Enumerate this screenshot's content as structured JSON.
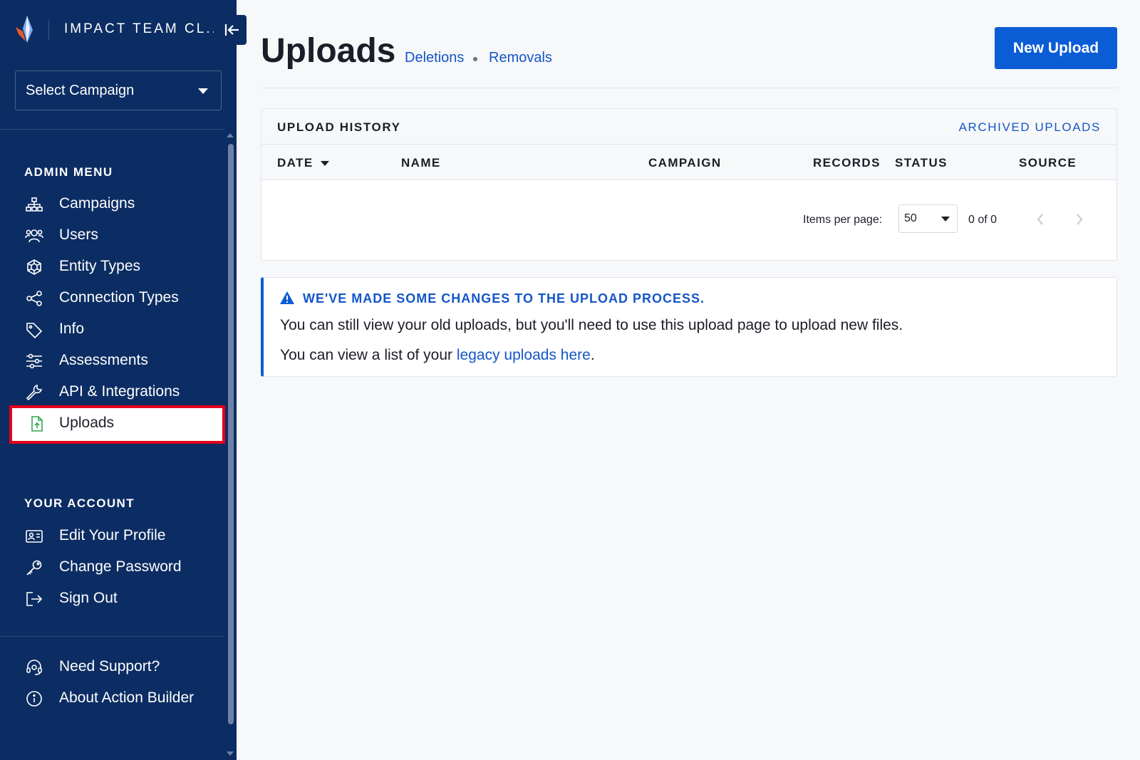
{
  "sidebar": {
    "org_name": "IMPACT TEAM CL...",
    "campaign_select": {
      "value": "Select Campaign"
    },
    "admin_menu_title": "ADMIN MENU",
    "admin_items": [
      {
        "label": "Campaigns",
        "icon": "sitemap-icon"
      },
      {
        "label": "Users",
        "icon": "users-icon"
      },
      {
        "label": "Entity Types",
        "icon": "hexagon-cube-icon"
      },
      {
        "label": "Connection Types",
        "icon": "share-nodes-icon"
      },
      {
        "label": "Info",
        "icon": "tag-icon"
      },
      {
        "label": "Assessments",
        "icon": "sliders-icon"
      },
      {
        "label": "API & Integrations",
        "icon": "wrench-icon"
      },
      {
        "label": "Uploads",
        "icon": "file-upload-icon",
        "active": true
      }
    ],
    "account_title": "YOUR ACCOUNT",
    "account_items": [
      {
        "label": "Edit Your Profile",
        "icon": "id-card-icon"
      },
      {
        "label": "Change Password",
        "icon": "key-icon"
      },
      {
        "label": "Sign Out",
        "icon": "sign-out-icon"
      }
    ],
    "footer_items": [
      {
        "label": "Need Support?",
        "icon": "headset-icon"
      },
      {
        "label": "About Action Builder",
        "icon": "info-circle-icon"
      }
    ]
  },
  "header": {
    "title": "Uploads",
    "links": [
      "Deletions",
      "Removals"
    ],
    "new_upload_label": "New Upload"
  },
  "upload_history": {
    "title": "UPLOAD HISTORY",
    "archived_link": "ARCHIVED UPLOADS",
    "columns": [
      "DATE",
      "NAME",
      "CAMPAIGN",
      "RECORDS",
      "STATUS",
      "SOURCE"
    ],
    "sorted_column": "DATE",
    "rows": [],
    "paginator": {
      "items_per_page_label": "Items per page:",
      "items_per_page_value": "50",
      "range_label": "0 of 0"
    }
  },
  "notice": {
    "title": "WE'VE MADE SOME CHANGES TO THE UPLOAD PROCESS.",
    "line1": "You can still view your old uploads, but you'll need to use this upload page to upload new files.",
    "line2_prefix": "You can view a list of your ",
    "line2_link": "legacy uploads here",
    "line2_suffix": "."
  },
  "colors": {
    "sidebar_bg": "#0c2d63",
    "primary": "#0b5dd6",
    "link": "#1456c7",
    "highlight_outline": "#e3001b",
    "upload_icon": "#2fa84f"
  }
}
